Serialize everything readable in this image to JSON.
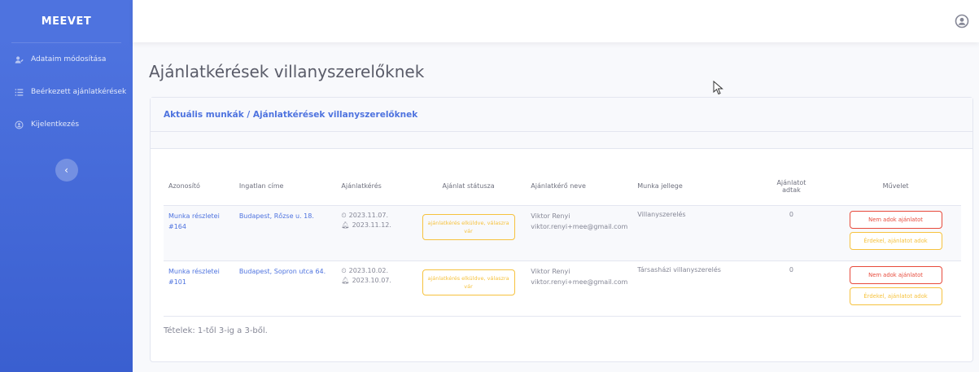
{
  "sidebar": {
    "brand": "MEEVET",
    "items": [
      {
        "label": "Adataim módosítása",
        "icon": "user-edit-icon"
      },
      {
        "label": "Beérkezett ajánlatkérések",
        "icon": "list-icon"
      },
      {
        "label": "Kijelentkezés",
        "icon": "logout-icon"
      }
    ],
    "toggle": "‹"
  },
  "header": {
    "title": "Ajánlatkérések villanyszerelőknek"
  },
  "card": {
    "breadcrumb": "Aktuális munkák / Ajánlatkérések villanyszerelőknek"
  },
  "table": {
    "columns": {
      "id": "Azonosító",
      "address": "Ingatlan címe",
      "request": "Ajánlatkérés",
      "status": "Ajánlat státusza",
      "requester": "Ajánlatkérő neve",
      "work": "Munka jellege",
      "offered": "Ajánlatot adtak",
      "action": "Művelet"
    },
    "rows": [
      {
        "id_label": "Munka részletei",
        "id_number": "#164",
        "address": "Budapest, Rőzse u. 18.",
        "date_created": "2023.11.07.",
        "date_deadline": "2023.11.12.",
        "status": "ajánlatkérés elküldve, válaszra vár",
        "requester_name": "Viktor Renyi",
        "requester_email": "viktor.renyi+mee@gmail.com",
        "work_type": "Villanyszerelés",
        "offered": "0",
        "btn_decline": "Nem adok ajánlatot",
        "btn_accept": "Érdekel, ajánlatot adok"
      },
      {
        "id_label": "Munka részletei",
        "id_number": "#101",
        "address": "Budapest, Sopron utca 64.",
        "date_created": "2023.10.02.",
        "date_deadline": "2023.10.07.",
        "status": "ajánlatkérés elküldve, válaszra vár",
        "requester_name": "Viktor Renyi",
        "requester_email": "viktor.renyi+mee@gmail.com",
        "work_type": "Társasházi villanyszerelés",
        "offered": "0",
        "btn_decline": "Nem adok ajánlatot",
        "btn_accept": "Érdekel, ajánlatot adok"
      }
    ]
  },
  "footer": {
    "count": "Tételek: 1-től 3-ig a 3-ből."
  },
  "icons": {
    "clock": "clock-icon",
    "bell": "bell-icon",
    "user": "user-circle-icon",
    "cursor": "mouse-cursor-icon"
  },
  "colors": {
    "primary": "#4e73df",
    "danger": "#e74a3b",
    "warning": "#f6c23e",
    "text": "#858796"
  }
}
